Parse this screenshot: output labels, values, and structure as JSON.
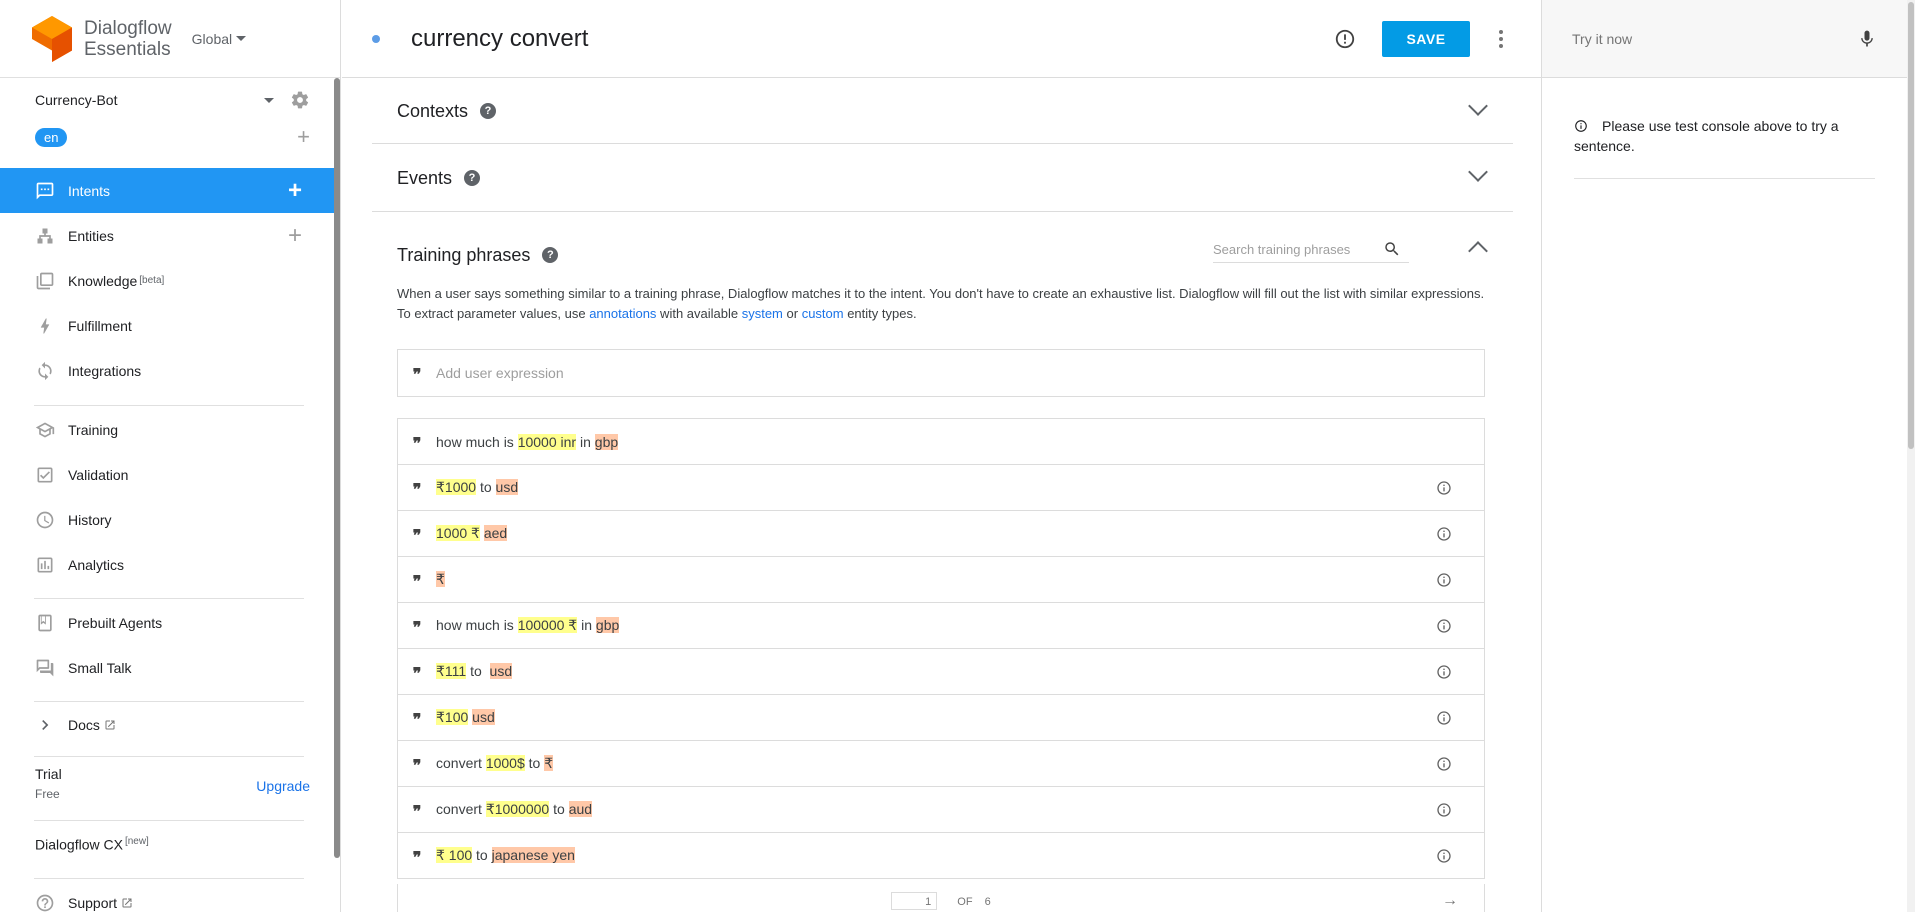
{
  "brand": {
    "line1": "Dialogflow",
    "line2": "Essentials",
    "region": "Global"
  },
  "agent": {
    "name": "Currency-Bot",
    "language": "en"
  },
  "nav": {
    "intents": "Intents",
    "entities": "Entities",
    "knowledge": "Knowledge",
    "knowledge_badge": "[beta]",
    "fulfillment": "Fulfillment",
    "integrations": "Integrations",
    "training": "Training",
    "validation": "Validation",
    "history": "History",
    "analytics": "Analytics",
    "prebuilt_agents": "Prebuilt Agents",
    "small_talk": "Small Talk",
    "docs": "Docs",
    "support": "Support"
  },
  "plan": {
    "label": "Trial",
    "tier": "Free",
    "upgrade": "Upgrade",
    "cx": "Dialogflow CX",
    "cx_badge": "[new]"
  },
  "header": {
    "intent_name": "currency convert",
    "save_label": "SAVE"
  },
  "test_console": {
    "placeholder": "Try it now",
    "hint": "Please use test console above to try a sentence."
  },
  "sections": {
    "contexts": "Contexts",
    "events": "Events",
    "training_phrases": "Training phrases"
  },
  "training": {
    "search_placeholder": "Search training phrases",
    "desc_1": "When a user says something similar to a training phrase, Dialogflow matches it to the intent. You don't have to create an exhaustive list. Dialogflow will fill out the list with similar expressions. To extract parameter values, use ",
    "link_annotations": "annotations",
    "desc_2": " with available ",
    "link_system": "system",
    "desc_3": " or ",
    "link_custom": "custom",
    "desc_4": " entity types.",
    "add_placeholder": "Add user expression",
    "phrases": [
      [
        [
          "how much is ",
          ""
        ],
        [
          "10000 inr",
          "y"
        ],
        [
          " in ",
          ""
        ],
        [
          "gbp",
          "o"
        ]
      ],
      [
        [
          "₹1000",
          "y"
        ],
        [
          " to ",
          ""
        ],
        [
          "usd",
          "o"
        ]
      ],
      [
        [
          "1000 ₹",
          "y"
        ],
        [
          " ",
          ""
        ],
        [
          "aed",
          "o"
        ]
      ],
      [
        [
          "₹",
          "o"
        ]
      ],
      [
        [
          "how much is ",
          ""
        ],
        [
          "100000 ₹",
          "y"
        ],
        [
          " in ",
          ""
        ],
        [
          "gbp",
          "o"
        ]
      ],
      [
        [
          "₹111",
          "y"
        ],
        [
          " to  ",
          ""
        ],
        [
          "usd",
          "o"
        ]
      ],
      [
        [
          "₹100",
          "y"
        ],
        [
          " ",
          ""
        ],
        [
          "usd",
          "o"
        ]
      ],
      [
        [
          "convert ",
          ""
        ],
        [
          "1000$",
          "y"
        ],
        [
          " to ",
          ""
        ],
        [
          "₹",
          "o"
        ]
      ],
      [
        [
          "convert ",
          ""
        ],
        [
          "₹1000000",
          "y"
        ],
        [
          " to ",
          ""
        ],
        [
          "aud",
          "o"
        ]
      ],
      [
        [
          "₹ 100",
          "y"
        ],
        [
          " to ",
          ""
        ],
        [
          "japanese yen",
          "o"
        ]
      ]
    ],
    "pager": {
      "page": "1",
      "of": "OF",
      "total": "6"
    }
  },
  "colors": {
    "accent": "#2196f3",
    "save": "#039be5",
    "param_yellow": "#ffff8d",
    "param_orange": "#ffc8a8",
    "logo": "#ef6c00"
  }
}
